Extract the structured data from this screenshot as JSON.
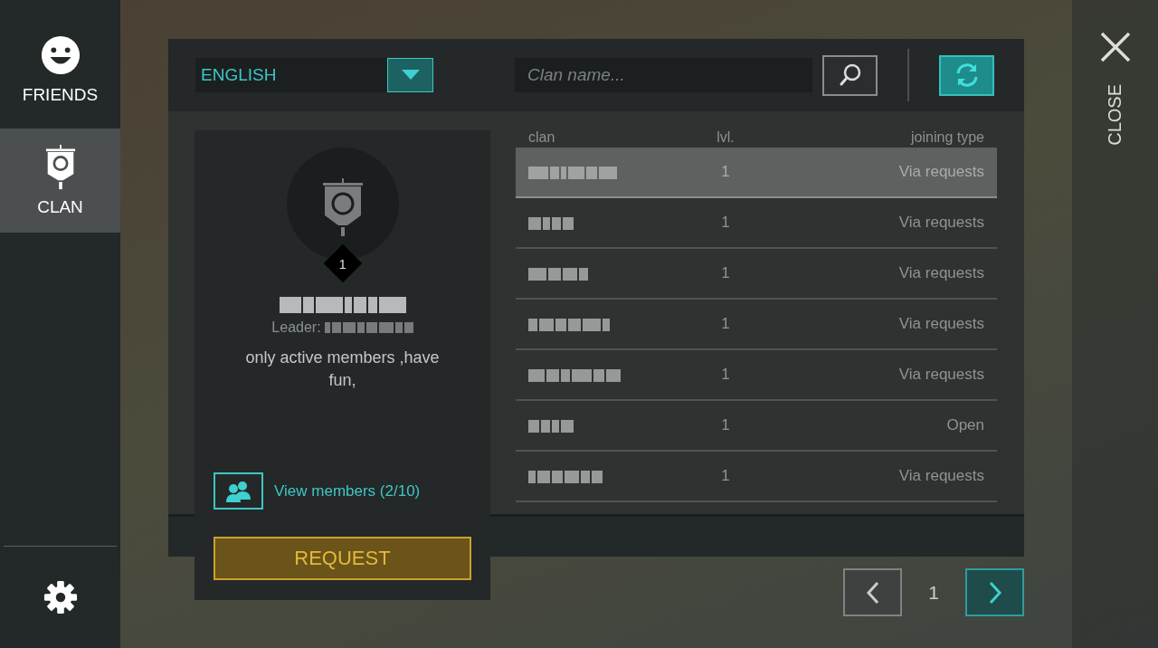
{
  "sidebar": {
    "items": [
      {
        "kind": "friends",
        "label": "FRIENDS",
        "selected": false
      },
      {
        "kind": "clan",
        "label": "CLAN",
        "selected": true
      }
    ]
  },
  "language": {
    "value": "ENGLISH"
  },
  "search": {
    "placeholder": "Clan name..."
  },
  "clan_card": {
    "rank_badge": "1",
    "leader_label": "Leader:",
    "description": "only active members ,have fun,",
    "view_members": "View members (2/10)",
    "request_button": "REQUEST"
  },
  "table": {
    "columns": [
      "clan",
      "lvl.",
      "joining type"
    ],
    "rows": [
      {
        "lvl": "1",
        "joining_type": "Via requests",
        "selected": true
      },
      {
        "lvl": "1",
        "joining_type": "Via requests",
        "selected": false
      },
      {
        "lvl": "1",
        "joining_type": "Via requests",
        "selected": false
      },
      {
        "lvl": "1",
        "joining_type": "Via requests",
        "selected": false
      },
      {
        "lvl": "1",
        "joining_type": "Via requests",
        "selected": false
      },
      {
        "lvl": "1",
        "joining_type": "Open",
        "selected": false
      },
      {
        "lvl": "1",
        "joining_type": "Via requests",
        "selected": false
      }
    ]
  },
  "pagination": {
    "page": "1"
  },
  "close": {
    "label": "CLOSE"
  }
}
